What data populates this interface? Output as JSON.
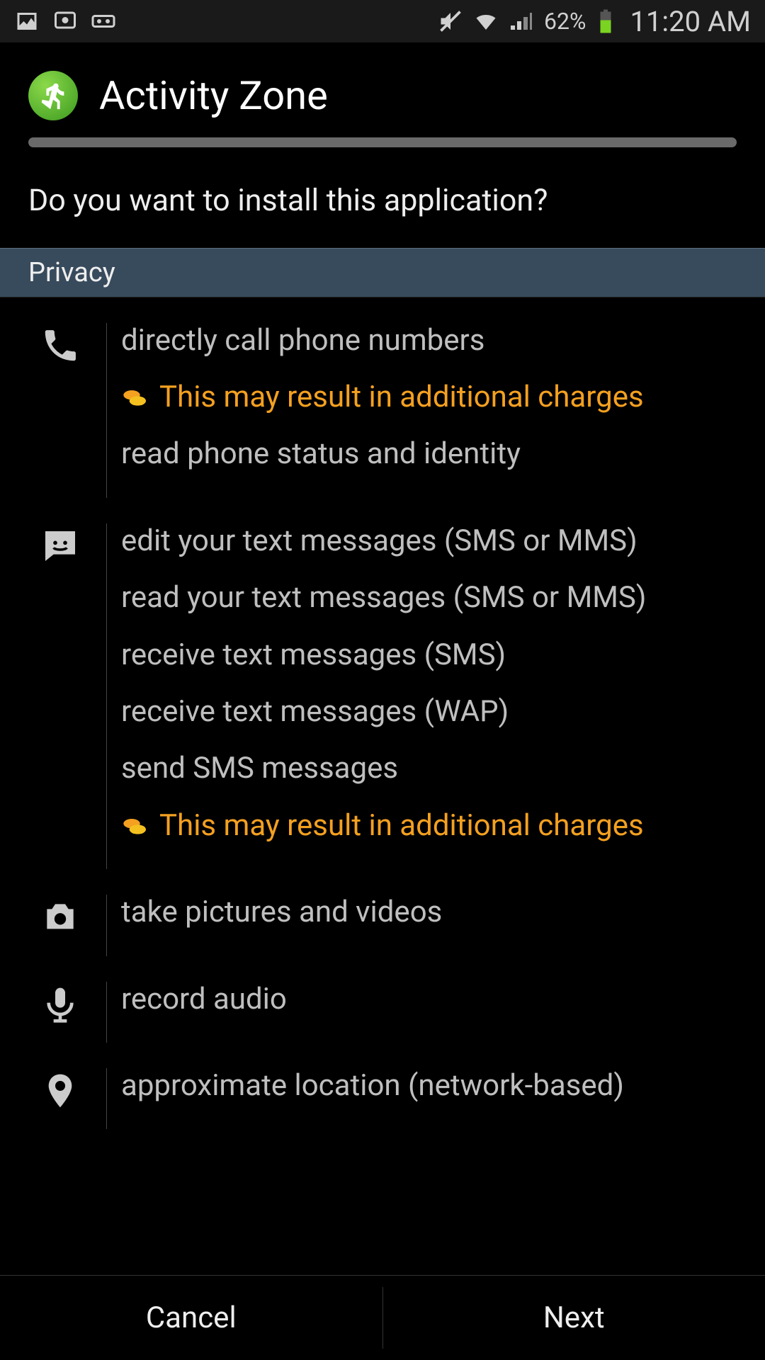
{
  "status": {
    "battery_pct": "62%",
    "time": "11:20 AM"
  },
  "header": {
    "app_name": "Activity Zone"
  },
  "prompt": "Do you want to install this application?",
  "section": {
    "privacy": "Privacy"
  },
  "perms": {
    "phone": {
      "l0": "directly call phone numbers",
      "w0": "This may result in additional charges",
      "l1": "read phone status and identity"
    },
    "sms": {
      "l0": "edit your text messages (SMS or MMS)",
      "l1": "read your text messages (SMS or MMS)",
      "l2": "receive text messages (SMS)",
      "l3": "receive text messages (WAP)",
      "l4": "send SMS messages",
      "w4": "This may result in additional charges"
    },
    "camera": {
      "l0": "take pictures and videos"
    },
    "mic": {
      "l0": "record audio"
    },
    "location": {
      "l0": "approximate location (network-based)"
    }
  },
  "buttons": {
    "cancel": "Cancel",
    "next": "Next"
  }
}
